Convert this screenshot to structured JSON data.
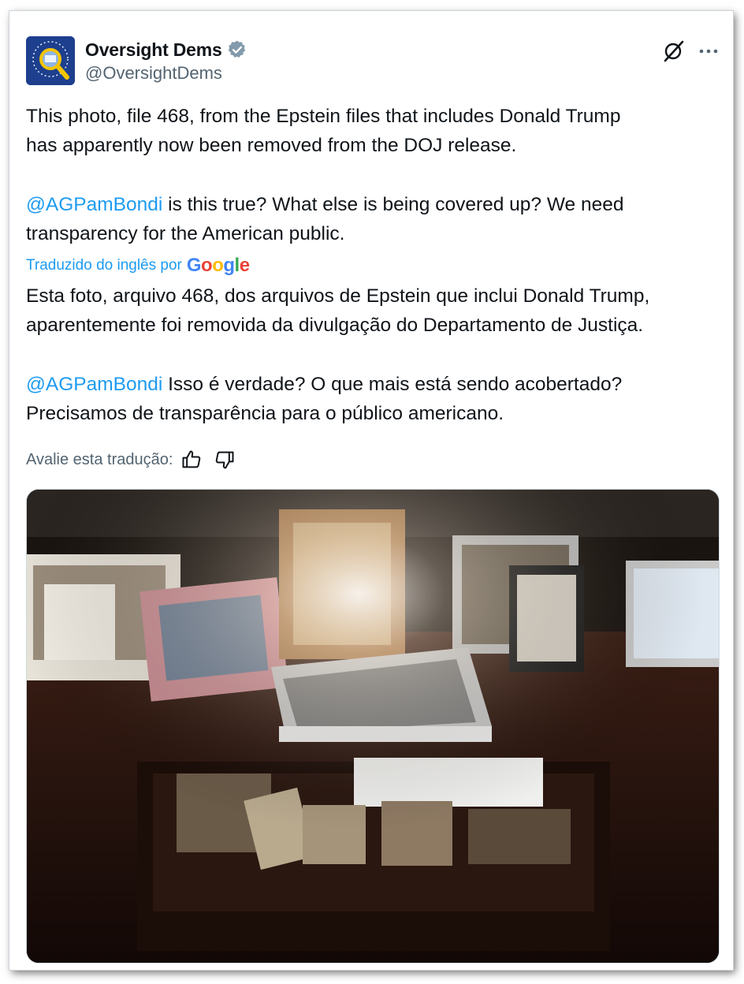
{
  "tweet": {
    "author": {
      "display_name": "Oversight Dems",
      "handle": "@OversightDems",
      "verified": true,
      "avatar_icon": "magnifying-glass-seal-icon"
    },
    "original": {
      "paragraph_1": "This photo, file 468, from the Epstein files that includes Donald Trump\nhas apparently now been removed from the DOJ release.",
      "mention": "@AGPamBondi",
      "paragraph_2_rest": " is this true? What else is being covered up? We need\ntransparency for the American public."
    },
    "translation": {
      "label": "Traduzido do inglês por",
      "provider": "Google",
      "paragraph_1": "Esta foto, arquivo 468, dos arquivos de Epstein que inclui Donald Trump,\naparentemente foi removida da divulgação do Departamento de Justiça.",
      "mention": "@AGPamBondi",
      "paragraph_2_rest": " Isso é verdade? O que mais está sendo acobertado?\nPrecisamos de transparência para o público americano.",
      "rate_label": "Avalie esta tradução:"
    },
    "icons": {
      "grok": "grok-icon",
      "more": "more-icon",
      "thumbs_up": "thumbs-up-icon",
      "thumbs_down": "thumbs-down-icon"
    },
    "colors": {
      "link": "#1d9bf0",
      "text": "#0f1419",
      "muted": "#536471",
      "verified_badge": "#829aab"
    }
  }
}
